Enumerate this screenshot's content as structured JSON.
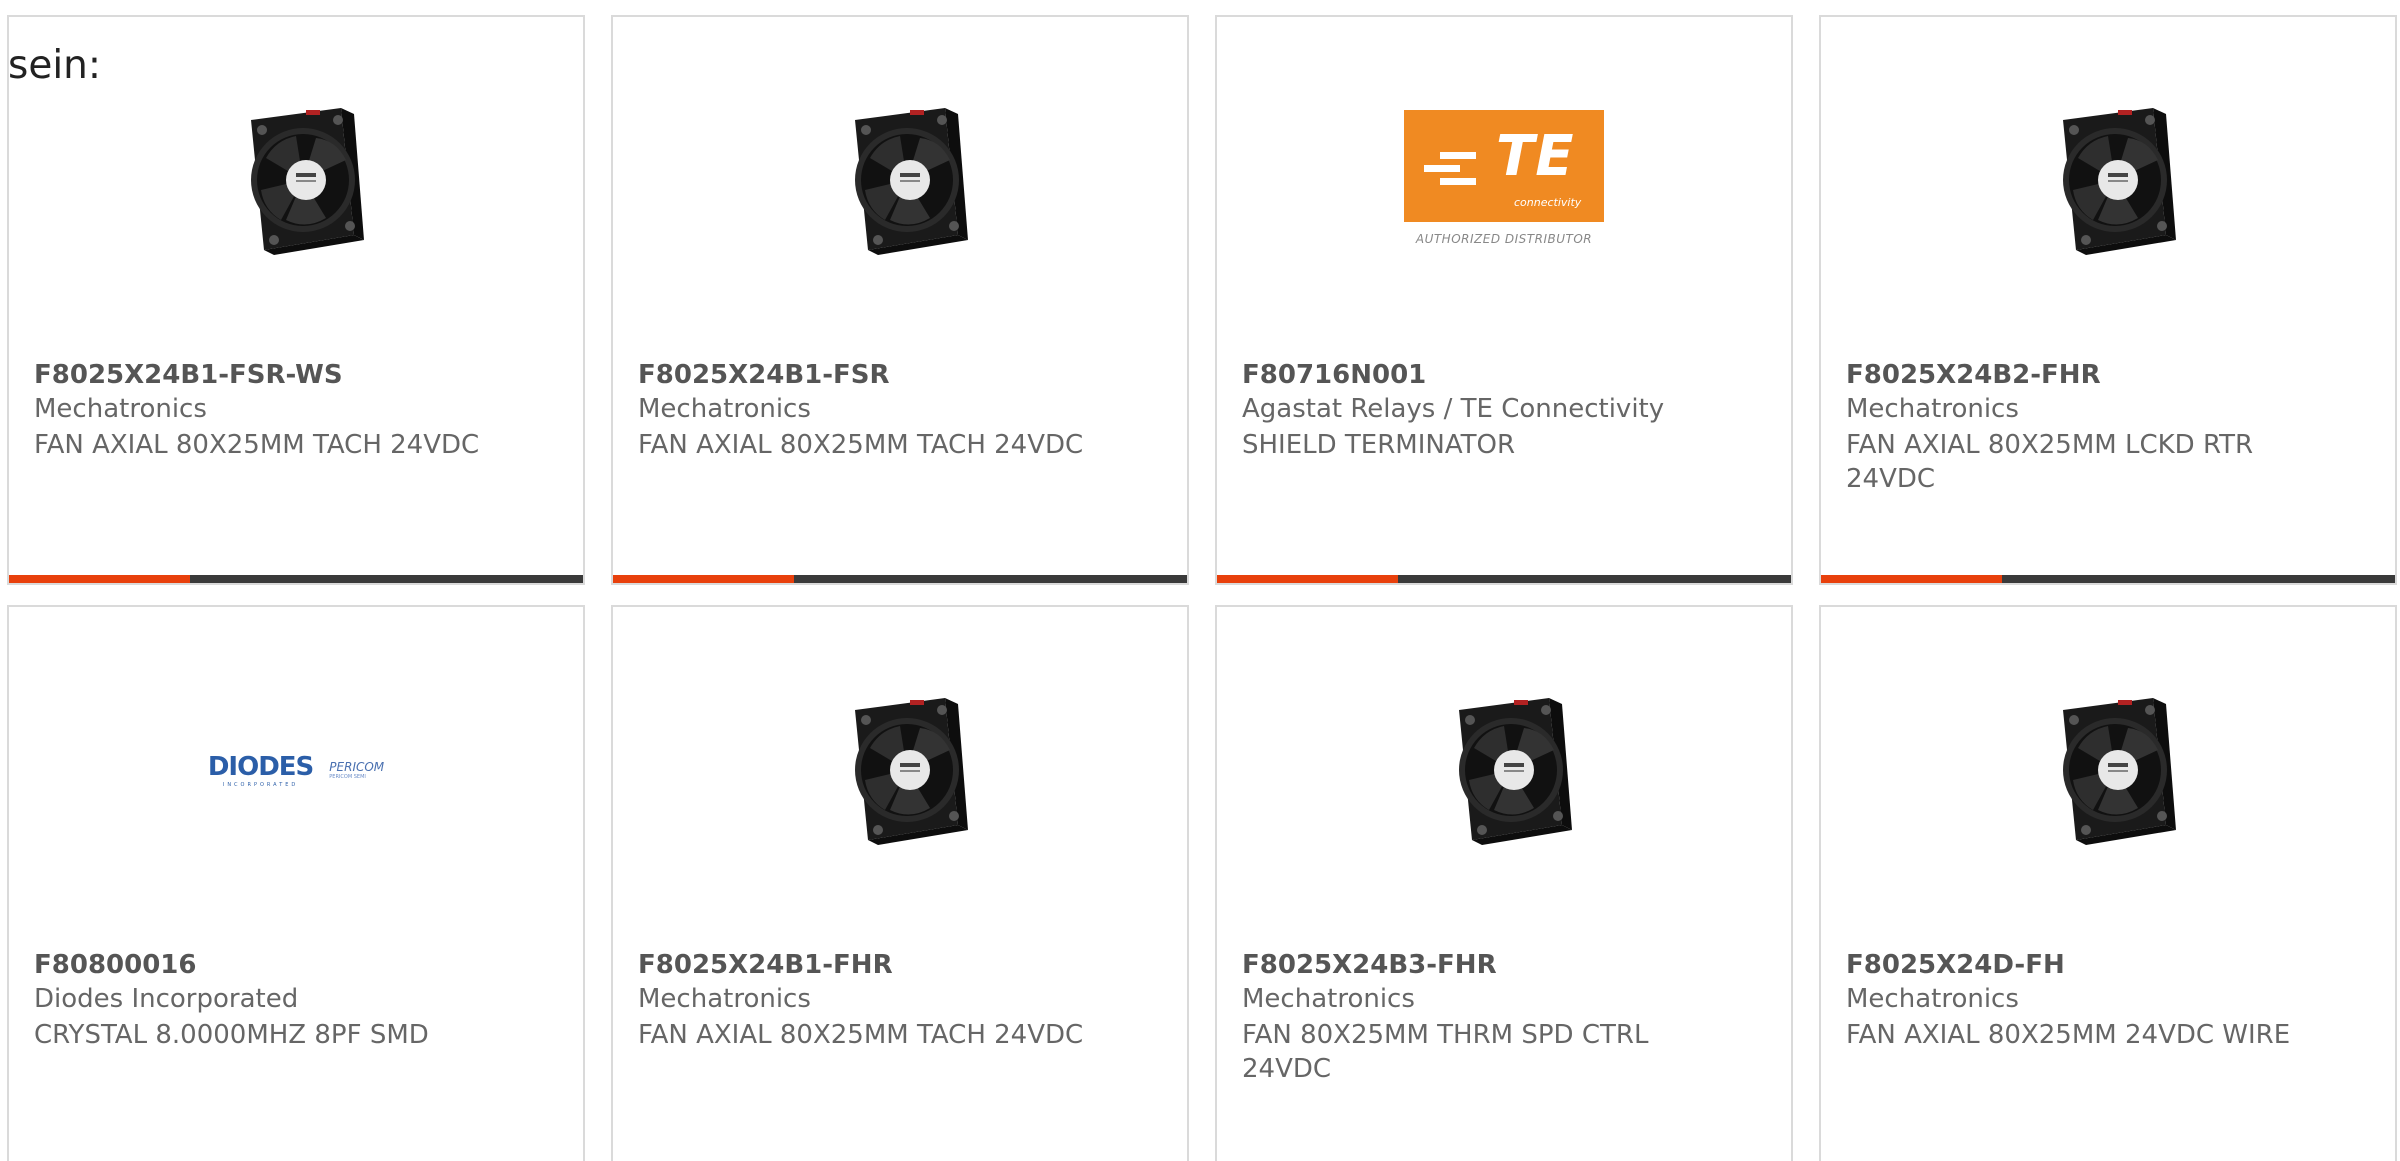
{
  "intro_text": "sein:",
  "colors": {
    "accent": "#e8400c",
    "bar_dark": "#3a3a3a",
    "te_orange": "#f08a22",
    "diodes_blue": "#2b5ea8"
  },
  "products": [
    {
      "part_number": "F8025X24B1-FSR-WS",
      "manufacturer": "Mechatronics",
      "description": "FAN AXIAL 80X25MM TACH 24VDC",
      "image": "fan-image"
    },
    {
      "part_number": "F8025X24B1-FSR",
      "manufacturer": "Mechatronics",
      "description": "FAN AXIAL 80X25MM TACH 24VDC",
      "image": "fan-image"
    },
    {
      "part_number": "F80716N001",
      "manufacturer": "Agastat Relays / TE Connectivity",
      "description": "SHIELD TERMINATOR",
      "image": "te-logo",
      "logo": {
        "word": "TE",
        "sub": "connectivity",
        "caption": "AUTHORIZED DISTRIBUTOR"
      }
    },
    {
      "part_number": "F8025X24B2-FHR",
      "manufacturer": "Mechatronics",
      "description": "FAN AXIAL 80X25MM LCKD RTR 24VDC",
      "image": "fan-image"
    },
    {
      "part_number": "F80800016",
      "manufacturer": "Diodes Incorporated",
      "description": "CRYSTAL 8.0000MHZ 8PF SMD",
      "image": "diodes-logo",
      "logo": {
        "word": "DIODES",
        "tag": "INCORPORATED",
        "partner": "PERICOM",
        "partner_tag": "PERICOM SEMI"
      }
    },
    {
      "part_number": "F8025X24B1-FHR",
      "manufacturer": "Mechatronics",
      "description": "FAN AXIAL 80X25MM TACH 24VDC",
      "image": "fan-image"
    },
    {
      "part_number": "F8025X24B3-FHR",
      "manufacturer": "Mechatronics",
      "description": "FAN 80X25MM THRM SPD CTRL 24VDC",
      "image": "fan-image"
    },
    {
      "part_number": "F8025X24D-FH",
      "manufacturer": "Mechatronics",
      "description": "FAN AXIAL 80X25MM 24VDC WIRE",
      "image": "fan-image"
    }
  ]
}
